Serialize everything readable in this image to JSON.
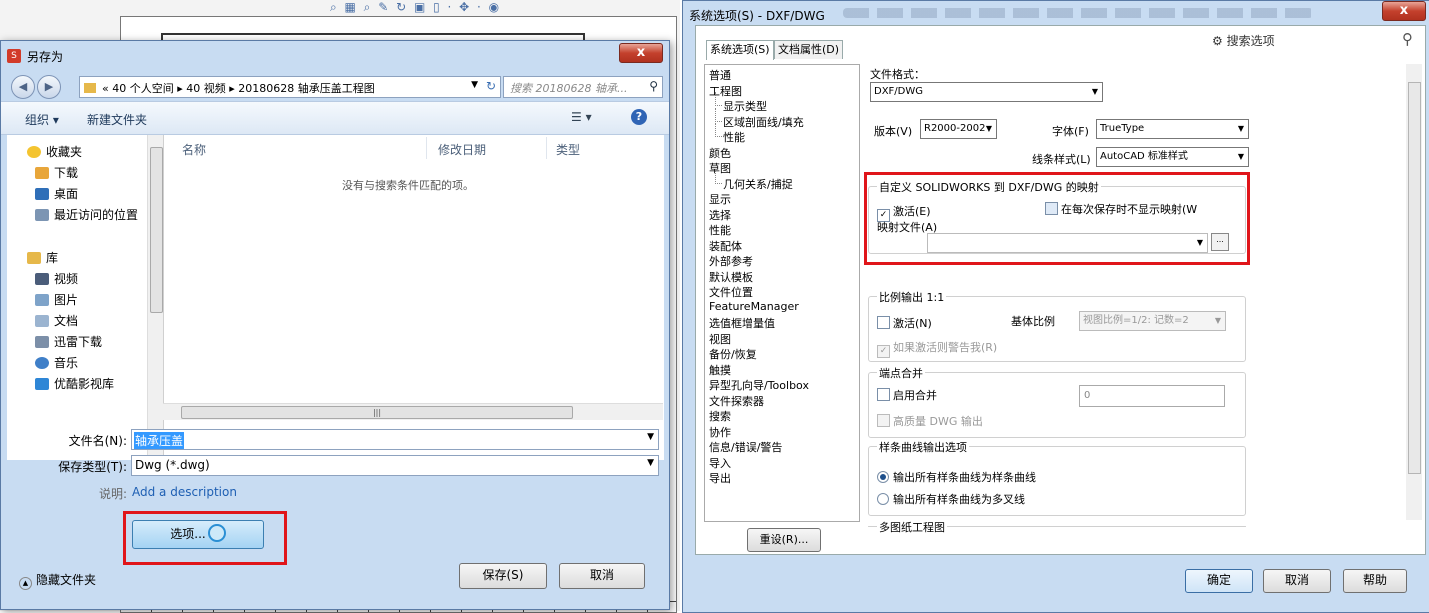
{
  "save_dialog": {
    "title": "另存为",
    "close_label": "x",
    "address": {
      "path": "« 40 个人空间 ▸ 40 视频 ▸ 20180628 轴承压盖工程图",
      "search_placeholder": "搜索 20180628 轴承..."
    },
    "toolbar": {
      "organize": "组织 ▾",
      "new_folder": "新建文件夹"
    },
    "favorites": [
      "收藏夹",
      "下载",
      "桌面",
      "最近访问的位置"
    ],
    "libraries": [
      "库",
      "视频",
      "图片",
      "文档",
      "迅雷下载",
      "音乐",
      "优酷影视库"
    ],
    "columns": [
      "名称",
      "修改日期",
      "类型"
    ],
    "empty_message": "没有与搜索条件匹配的项。",
    "file_name_label": "文件名(N):",
    "file_name_value": "轴承压盖",
    "save_type_label": "保存类型(T):",
    "save_type_value": "Dwg (*.dwg)",
    "description_label": "说明:",
    "description_link": "Add a description",
    "options_button": "选项...",
    "hide_folders": "隐藏文件夹",
    "save_button": "保存(S)",
    "cancel_button": "取消"
  },
  "system_options": {
    "title": "系统选项(S) - DXF/DWG",
    "close_label": "x",
    "tabs": [
      "系统选项(S)",
      "文档属性(D)"
    ],
    "search_label": "搜索选项",
    "tree": [
      {
        "label": "普通",
        "sub": false
      },
      {
        "label": "工程图",
        "sub": false
      },
      {
        "label": "显示类型",
        "sub": true
      },
      {
        "label": "区域剖面线/填充",
        "sub": true
      },
      {
        "label": "性能",
        "sub": true
      },
      {
        "label": "颜色",
        "sub": false
      },
      {
        "label": "草图",
        "sub": false
      },
      {
        "label": "几何关系/捕捉",
        "sub": true
      },
      {
        "label": "显示",
        "sub": false
      },
      {
        "label": "选择",
        "sub": false
      },
      {
        "label": "性能",
        "sub": false
      },
      {
        "label": "装配体",
        "sub": false
      },
      {
        "label": "外部参考",
        "sub": false
      },
      {
        "label": "默认模板",
        "sub": false
      },
      {
        "label": "文件位置",
        "sub": false
      },
      {
        "label": "FeatureManager",
        "sub": false
      },
      {
        "label": "选值框增量值",
        "sub": false
      },
      {
        "label": "视图",
        "sub": false
      },
      {
        "label": "备份/恢复",
        "sub": false
      },
      {
        "label": "触摸",
        "sub": false
      },
      {
        "label": "异型孔向导/Toolbox",
        "sub": false
      },
      {
        "label": "文件探索器",
        "sub": false
      },
      {
        "label": "搜索",
        "sub": false
      },
      {
        "label": "协作",
        "sub": false
      },
      {
        "label": "信息/错误/警告",
        "sub": false
      },
      {
        "label": "导入",
        "sub": false
      },
      {
        "label": "导出",
        "sub": false
      }
    ],
    "reset_button": "重设(R)...",
    "file_format_label": "文件格式：",
    "file_format_value": "DXF/DWG",
    "version_label": "版本(V)",
    "version_value": "R2000-2002",
    "font_label": "字体(F)",
    "font_value": "TrueType",
    "line_style_label": "线条样式(L)",
    "line_style_value": "AutoCAD 标准样式",
    "mapping_group": {
      "legend": "自定义 SOLIDWORKS 到 DXF/DWG 的映射",
      "activate": "激活(E)",
      "no_show": "在每次保存时不显示映射(W",
      "map_file_label": "映射文件(A)",
      "browse": "..."
    },
    "scale_group": {
      "legend": "比例输出 1:1",
      "activate": "激活(N)",
      "base_scale_label": "基体比例",
      "base_scale_value": "视图比例=1/2: 记数=2",
      "warn": "如果激活则警告我(R)"
    },
    "merge_group": {
      "legend": "端点合并",
      "enable": "启用合并",
      "value": "0",
      "hq": "高质量 DWG 输出"
    },
    "spline_group": {
      "legend": "样条曲线输出选项",
      "opt1": "输出所有样条曲线为样条曲线",
      "opt2": "输出所有样条曲线为多叉线"
    },
    "multisheet_group": {
      "legend": "多图纸工程图"
    },
    "ok_button": "确定",
    "cancel_button": "取消",
    "help_button": "帮助"
  },
  "colors": {
    "highlight_red": "#e0151a",
    "dialog_frame": "#c8dcf2",
    "link_blue": "#1e5fb3",
    "selection_blue": "#3399ff"
  }
}
